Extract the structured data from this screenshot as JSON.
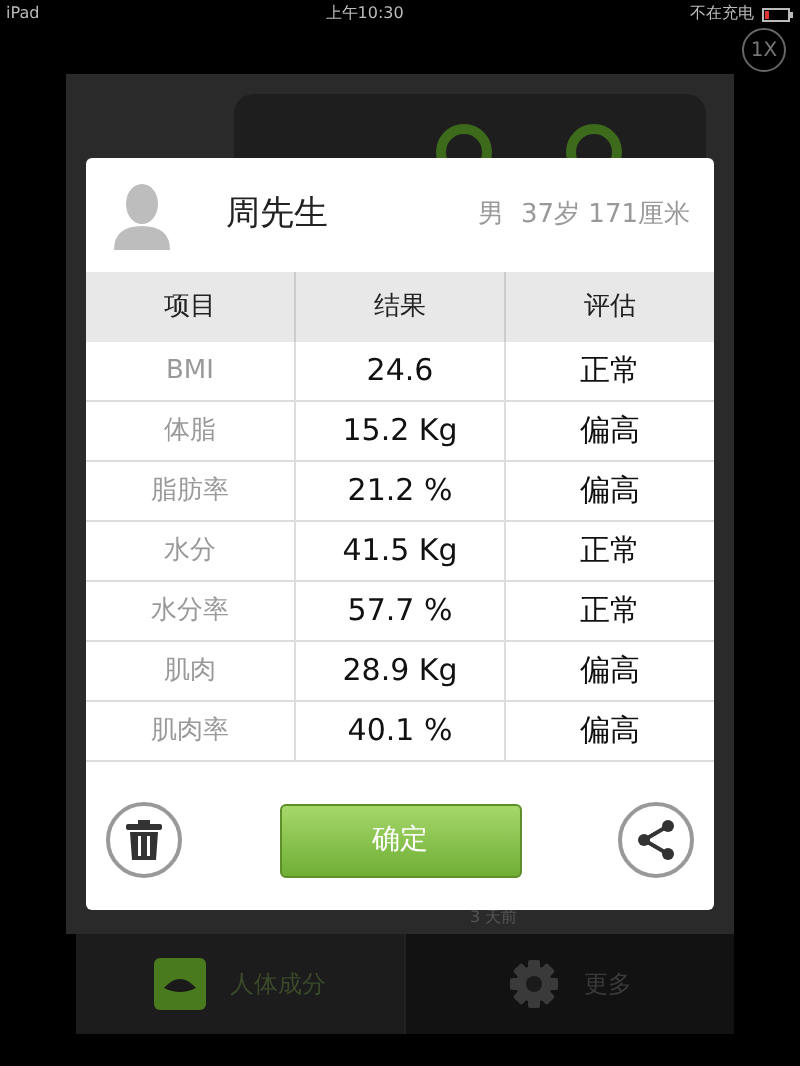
{
  "status_bar": {
    "device": "iPad",
    "time": "上午10:30",
    "charging": "不在充电"
  },
  "speed_button": "1X",
  "background": {
    "note": "3 天前"
  },
  "dialog": {
    "name": "周先生",
    "details": "男  37岁 171厘米",
    "table": {
      "columns": [
        "项目",
        "结果",
        "评估"
      ],
      "rows": [
        [
          "BMI",
          "24.6",
          "正常"
        ],
        [
          "体脂",
          "15.2 Kg",
          "偏高"
        ],
        [
          "脂肪率",
          "21.2 %",
          "偏高"
        ],
        [
          "水分",
          "41.5 Kg",
          "正常"
        ],
        [
          "水分率",
          "57.7 %",
          "正常"
        ],
        [
          "肌肉",
          "28.9 Kg",
          "偏高"
        ],
        [
          "肌肉率",
          "40.1 %",
          "偏高"
        ]
      ]
    },
    "confirm_button": "确定"
  },
  "tabs": [
    {
      "label": "人体成分",
      "selected": true,
      "kind": "scale"
    },
    {
      "label": "更多",
      "selected": false,
      "kind": "gear"
    }
  ]
}
